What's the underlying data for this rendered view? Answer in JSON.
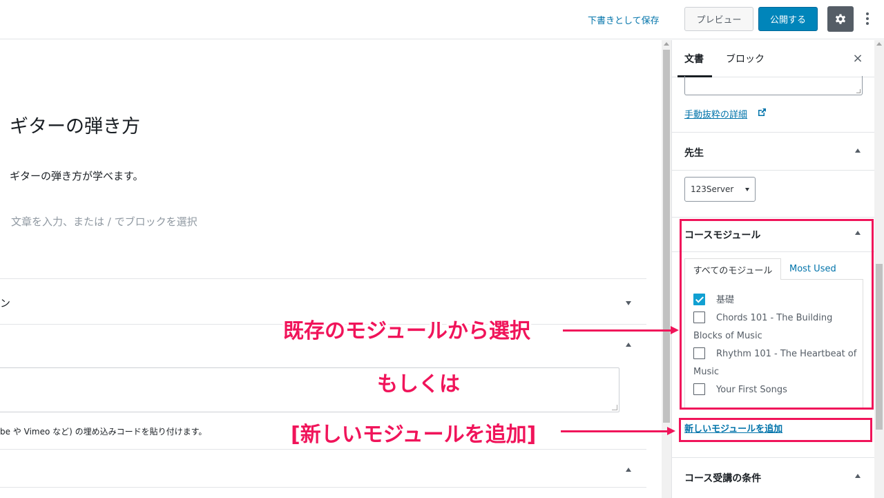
{
  "topbar": {
    "save_draft": "下書きとして保存",
    "preview": "プレビュー",
    "publish": "公開する"
  },
  "editor": {
    "title": "ギターの弾き方",
    "paragraph": "ギターの弾き方が学べます。",
    "placeholder": "文章を入力、または / でブロックを選択",
    "meta_row1_label": "ン",
    "embed_help": "be や Vimeo など) の埋め込みコードを貼り付けます。"
  },
  "sidebar": {
    "tab_document": "文書",
    "tab_block": "ブロック",
    "close": "×",
    "excerpt_link": "手動抜粋の詳細",
    "teacher_title": "先生",
    "teacher_selected": "123Server",
    "modules_title": "コースモジュール",
    "tab_all_modules": "すべてのモジュール",
    "tab_most_used": "Most Used",
    "modules": [
      {
        "label": "基礎",
        "checked": true
      },
      {
        "label": "Chords 101 - The Building",
        "cont": "Blocks of Music",
        "checked": false
      },
      {
        "label": "Rhythm 101 - The Heartbeat of",
        "cont": "Music",
        "checked": false
      },
      {
        "label": "Your First Songs",
        "checked": false
      }
    ],
    "add_module_link": "新しいモジュールを追加",
    "prereq_title": "コース受講の条件"
  },
  "annotations": {
    "select_existing": "既存のモジュールから選択",
    "or": "もしくは",
    "add_new": "[新しいモジュールを追加]",
    "color": "#f0145a"
  }
}
